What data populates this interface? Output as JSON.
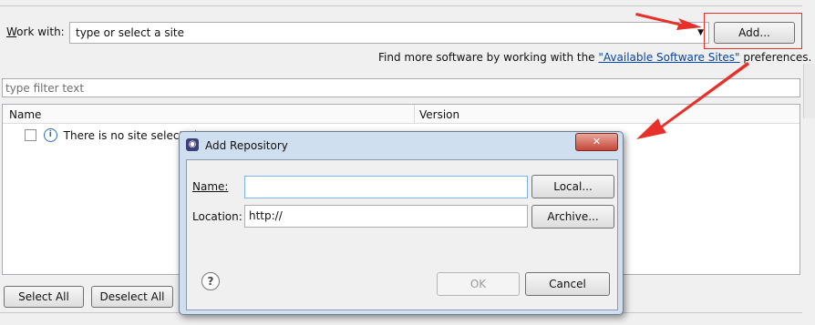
{
  "work_with": {
    "label_prefix": "W",
    "label_rest": "ork with:",
    "value": "type or select a site",
    "add_button": "Add..."
  },
  "find_more": {
    "prefix": "Find more software by working with the ",
    "link": "\"Available Software Sites\"",
    "suffix": " preferences."
  },
  "filter": {
    "placeholder": "type filter text"
  },
  "table": {
    "columns": [
      "Name",
      "Version"
    ],
    "rows": [
      {
        "name": "There is no site selected.",
        "checked": false
      }
    ]
  },
  "footer": {
    "select_all": "Select All",
    "deselect_all": "Deselect All"
  },
  "dialog": {
    "title": "Add Repository",
    "close_glyph": "✕",
    "name_label": "Name:",
    "name_value": "",
    "location_label": "Location:",
    "location_value": "http://",
    "local_button": "Local...",
    "archive_button": "Archive...",
    "ok_button": "OK",
    "cancel_button": "Cancel",
    "help_glyph": "?"
  },
  "colors": {
    "annotation": "#e8302a",
    "link": "#0645ad"
  }
}
